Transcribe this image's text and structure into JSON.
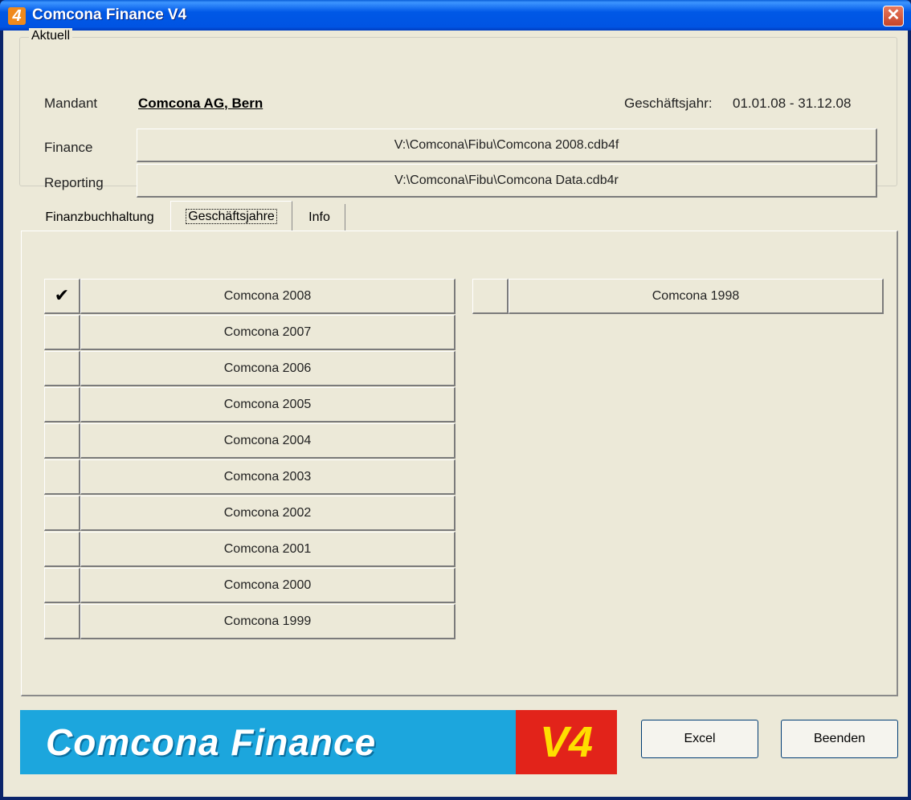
{
  "window": {
    "app_icon_glyph": "4",
    "title": "Comcona Finance V4",
    "close_glyph": "✕"
  },
  "current": {
    "legend": "Aktuell",
    "client_label": "Mandant",
    "client_name": "Comcona AG, Bern",
    "fiscal_year_label": "Geschäftsjahr:",
    "fiscal_year_range": "01.01.08 - 31.12.08",
    "finance_label": "Finance",
    "finance_path": "V:\\Comcona\\Fibu\\Comcona 2008.cdb4f",
    "reporting_label": "Reporting",
    "reporting_path": "V:\\Comcona\\Fibu\\Comcona Data.cdb4r"
  },
  "tabs": [
    {
      "label": "Finanzbuchhaltung",
      "active": false
    },
    {
      "label": "Geschäftsjahre",
      "active": true
    },
    {
      "label": "Info",
      "active": false
    }
  ],
  "years_left": [
    {
      "label": "Comcona 2008",
      "check": "✔"
    },
    {
      "label": "Comcona 2007",
      "check": ""
    },
    {
      "label": "Comcona 2006",
      "check": ""
    },
    {
      "label": "Comcona 2005",
      "check": ""
    },
    {
      "label": "Comcona 2004",
      "check": ""
    },
    {
      "label": "Comcona 2003",
      "check": ""
    },
    {
      "label": "Comcona 2002",
      "check": ""
    },
    {
      "label": "Comcona 2001",
      "check": ""
    },
    {
      "label": "Comcona 2000",
      "check": ""
    },
    {
      "label": "Comcona 1999",
      "check": ""
    }
  ],
  "years_right": [
    {
      "label": "Comcona 1998",
      "check": ""
    }
  ],
  "banner": {
    "text": "Comcona Finance",
    "version": "V4",
    "blue": "#1ca6dd",
    "red": "#e2231a",
    "yellow": "#ffde00"
  },
  "buttons": {
    "excel": "Excel",
    "quit": "Beenden"
  }
}
